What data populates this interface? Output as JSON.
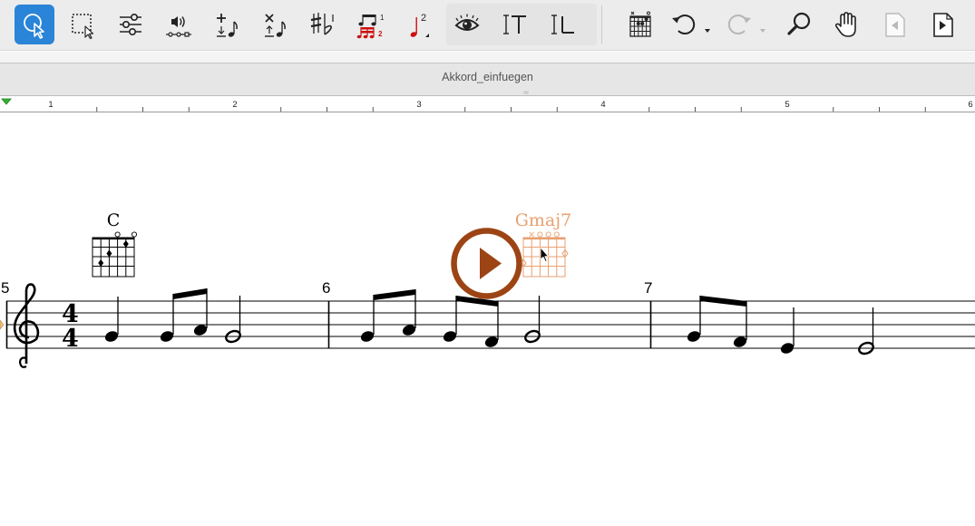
{
  "toolbar": {
    "tools": [
      {
        "id": "select-tool",
        "icon": "cursor-select-icon",
        "active": true
      },
      {
        "id": "marquee-tool",
        "icon": "marquee-select-icon"
      },
      {
        "id": "mixer-tool",
        "icon": "sliders-icon"
      },
      {
        "id": "playback-tool",
        "icon": "speaker-icon"
      },
      {
        "id": "add-note-tool",
        "icon": "add-note-icon"
      },
      {
        "id": "delete-note-tool",
        "icon": "delete-note-icon"
      },
      {
        "id": "accidentals-tool",
        "icon": "sharp-flat-icon"
      },
      {
        "id": "tuplet-tool",
        "icon": "tuplet-icon"
      },
      {
        "id": "voice-tool",
        "icon": "voice-2-icon"
      },
      {
        "id": "view-tool",
        "icon": "eye-icon"
      },
      {
        "id": "text-tool",
        "icon": "text-cursor-icon"
      },
      {
        "id": "lyrics-tool",
        "icon": "lyrics-cursor-icon"
      },
      {
        "id": "chord-diagram-tool",
        "icon": "chord-grid-icon"
      },
      {
        "id": "undo-tool",
        "icon": "undo-icon"
      },
      {
        "id": "redo-tool",
        "icon": "redo-icon",
        "disabled": true
      },
      {
        "id": "zoom-tool",
        "icon": "magnifier-icon"
      },
      {
        "id": "hand-tool",
        "icon": "hand-icon"
      },
      {
        "id": "prev-page-tool",
        "icon": "page-prev-icon",
        "disabled": true
      },
      {
        "id": "next-page-tool",
        "icon": "page-next-icon"
      }
    ]
  },
  "document": {
    "title": "Akkord_einfuegen"
  },
  "ruler": {
    "labels": [
      "1",
      "2",
      "3",
      "4",
      "5",
      "6"
    ]
  },
  "score": {
    "measure_numbers": [
      "5",
      "6",
      "7"
    ],
    "time_signature": {
      "numerator": "4",
      "denominator": "4"
    },
    "chords": [
      {
        "name": "C",
        "selected": false
      },
      {
        "name": "Gmaj7",
        "selected": true,
        "color": "#e8a070"
      }
    ],
    "colors": {
      "accent_selection": "#2a84d8",
      "play_button": "#9c4414",
      "selected_chord": "#e8a070",
      "playhead_marker": "#2fb52f"
    }
  }
}
